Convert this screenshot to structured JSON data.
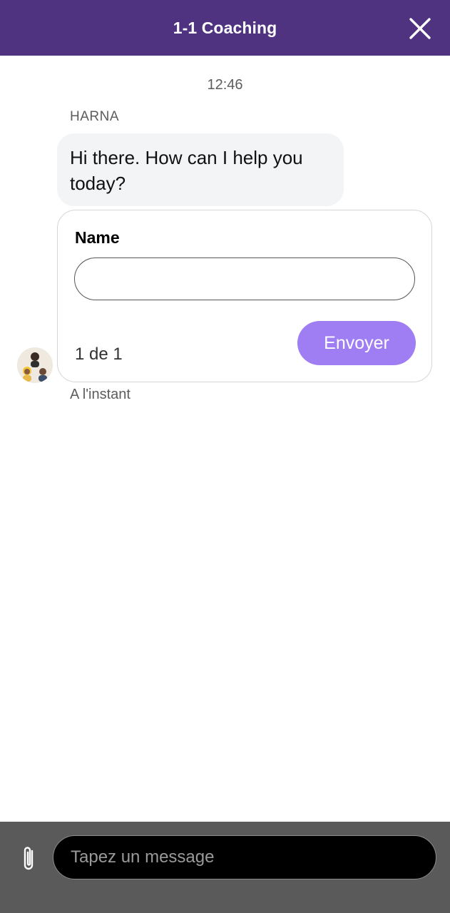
{
  "header": {
    "title": "1-1 Coaching",
    "close_icon": "close-icon",
    "background": "#4f3381"
  },
  "conversation": {
    "time": "12:46",
    "sender": "HARNA",
    "message": "Hi there. How can I help you today?",
    "timestamp": "A l'instant",
    "avatar_icon": "agent-avatar"
  },
  "form": {
    "field_label": "Name",
    "name_value": "",
    "pager": "1 de 1",
    "submit_label": "Envoyer",
    "submit_color": "#9f7ef4"
  },
  "composer": {
    "attach_icon": "paperclip-icon",
    "placeholder": "Tapez un message",
    "value": ""
  }
}
